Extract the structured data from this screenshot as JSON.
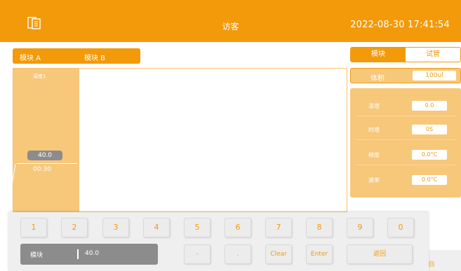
{
  "header": {
    "icon": "document-icon",
    "title": "访客",
    "datetime": "2022-08-30 17:41:54"
  },
  "module_tabs": [
    "模块 A",
    "模块 B"
  ],
  "right_tabs": {
    "active": "模块",
    "inactive": "试管"
  },
  "graph": {
    "step_label": "温度1",
    "temperature": "40.0",
    "time": "00:30"
  },
  "volume": {
    "label": "体积",
    "value": "100ul"
  },
  "params": [
    {
      "label": "温增",
      "value": "0.0"
    },
    {
      "label": "时增",
      "value": "0S"
    },
    {
      "label": "梯度",
      "value": "0.0°C"
    },
    {
      "label": "速率",
      "value": "0.0°C"
    }
  ],
  "keypad": {
    "digits": [
      "1",
      "2",
      "3",
      "4",
      "5",
      "6",
      "7",
      "8",
      "9",
      "0"
    ],
    "minus": "-",
    "dot": ".",
    "clear": "Clear",
    "enter": "Enter",
    "back": "返回",
    "display_label": "模块",
    "display_value": "40.0"
  },
  "peek_text": "回",
  "colors": {
    "accent": "#f39a0b",
    "accent_light": "#f7c77a",
    "display_grey": "#8c8c8c"
  }
}
